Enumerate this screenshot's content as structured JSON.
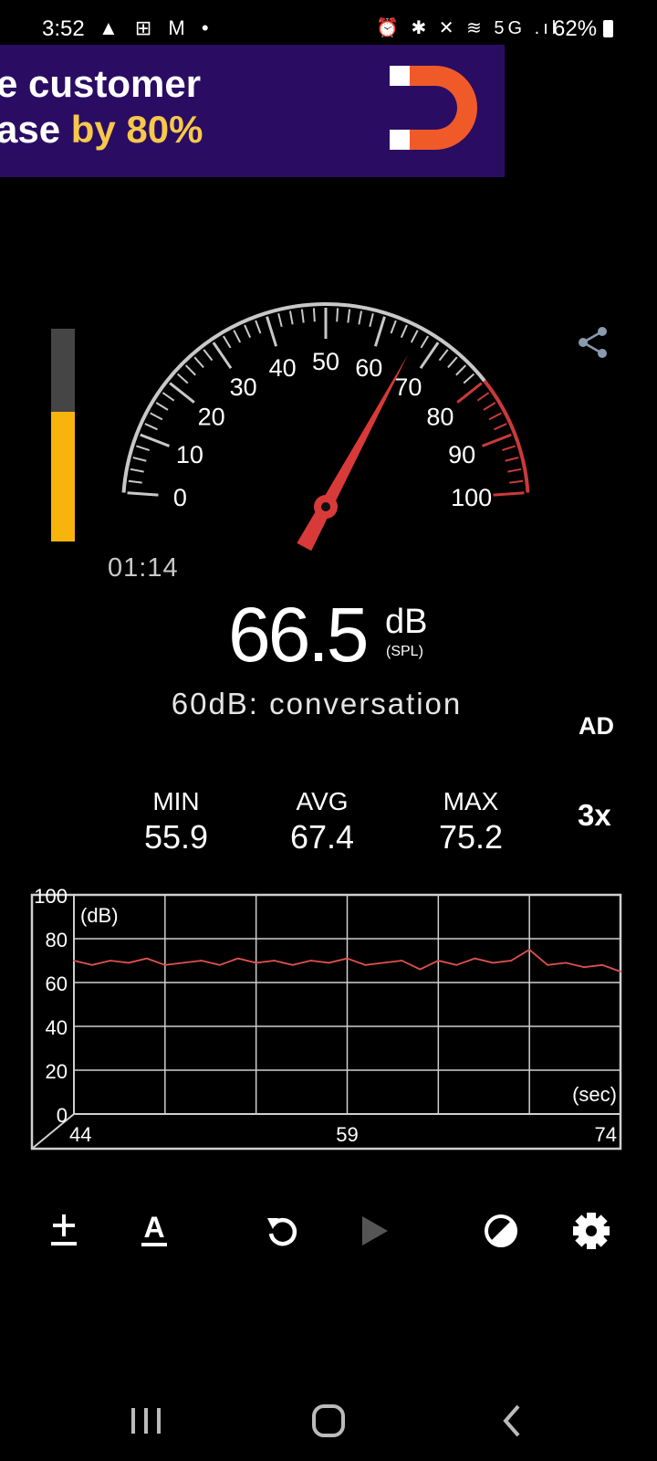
{
  "status_bar": {
    "time": "3:52",
    "left_icons": "▲ ⊞ M •",
    "right_icons": "⏰ ✱ ✕ ≋ 5G .ıl",
    "battery": "62%"
  },
  "ad": {
    "line1": "e customer",
    "line2_prefix": "ase ",
    "line2_highlight": "by 80%"
  },
  "level": {
    "fraction": 0.61,
    "color": "#f8b40d",
    "track_color": "#454545"
  },
  "gauge": {
    "ticks": [
      "0",
      "10",
      "20",
      "30",
      "40",
      "50",
      "60",
      "70",
      "80",
      "90",
      "100"
    ],
    "needle_value": 66.5,
    "red_zone_start": 80,
    "colors": {
      "scale": "#c8c8c8",
      "red": "#c93a3a",
      "needle": "#d83a3a"
    }
  },
  "timer": "01:14",
  "reading": {
    "value": "66.5",
    "unit": "dB",
    "subunit": "(SPL)"
  },
  "reference": "60dB: conversation",
  "controls": {
    "ad": "AD",
    "speed": "3x"
  },
  "stats": [
    {
      "label": "MIN",
      "value": "55.9"
    },
    {
      "label": "AVG",
      "value": "67.4"
    },
    {
      "label": "MAX",
      "value": "75.2"
    }
  ],
  "chart_data": {
    "type": "line",
    "y_ticks": [
      "100",
      "80",
      "60",
      "40",
      "20",
      "0"
    ],
    "ylim": [
      0,
      100
    ],
    "ylabel": "(dB)",
    "x_ticks": [
      "44",
      "59",
      "74"
    ],
    "xlim": [
      44,
      74
    ],
    "xlabel": "(sec)",
    "grid": true,
    "series": [
      {
        "color": "#e05050",
        "x": [
          44,
          45,
          46,
          47,
          48,
          49,
          50,
          51,
          52,
          53,
          54,
          55,
          56,
          57,
          58,
          59,
          60,
          61,
          62,
          63,
          64,
          65,
          66,
          67,
          68,
          69,
          70,
          71,
          72,
          73,
          74
        ],
        "y": [
          70,
          68,
          70,
          69,
          71,
          68,
          69,
          70,
          68,
          71,
          69,
          70,
          68,
          70,
          69,
          71,
          68,
          69,
          70,
          66,
          70,
          68,
          71,
          69,
          70,
          75,
          68,
          69,
          67,
          68,
          65
        ]
      }
    ]
  },
  "toolbar": [
    {
      "name": "calibrate-button",
      "icon": "plus-minus-icon"
    },
    {
      "name": "weighting-button",
      "icon": "a-weighting-icon"
    },
    {
      "name": "reset-button",
      "icon": "refresh-icon"
    },
    {
      "name": "play-button",
      "icon": "play-icon"
    },
    {
      "name": "theme-button",
      "icon": "contrast-icon"
    },
    {
      "name": "settings-button",
      "icon": "gear-icon"
    }
  ]
}
